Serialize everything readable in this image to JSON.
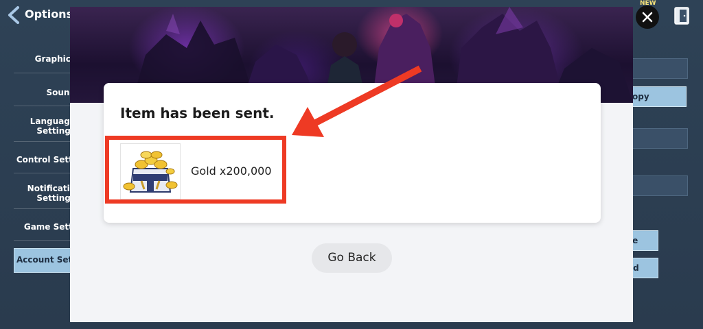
{
  "header": {
    "title": "Options",
    "new_badge": "NEW"
  },
  "sidebar": {
    "items": [
      {
        "label": "Graphics"
      },
      {
        "label": "Sound"
      },
      {
        "label": "Language\nSettings"
      },
      {
        "label": "Control Setti"
      },
      {
        "label": "Notificatio\nSettings"
      },
      {
        "label": "Game Setti"
      },
      {
        "label": "Account Sett"
      }
    ],
    "active_index": 6
  },
  "right_panel": {
    "copy_button": "opy",
    "button_2": "ce",
    "button_3": "ed"
  },
  "dialog": {
    "title": "Item has been sent.",
    "item": {
      "name": "Gold x200,000",
      "icon": "gold-chest-icon"
    },
    "go_back_label": "Go Back"
  },
  "colors": {
    "highlight": "#ee3a24",
    "accent_button": "#9cc4e0",
    "background": "#2c3e52"
  }
}
